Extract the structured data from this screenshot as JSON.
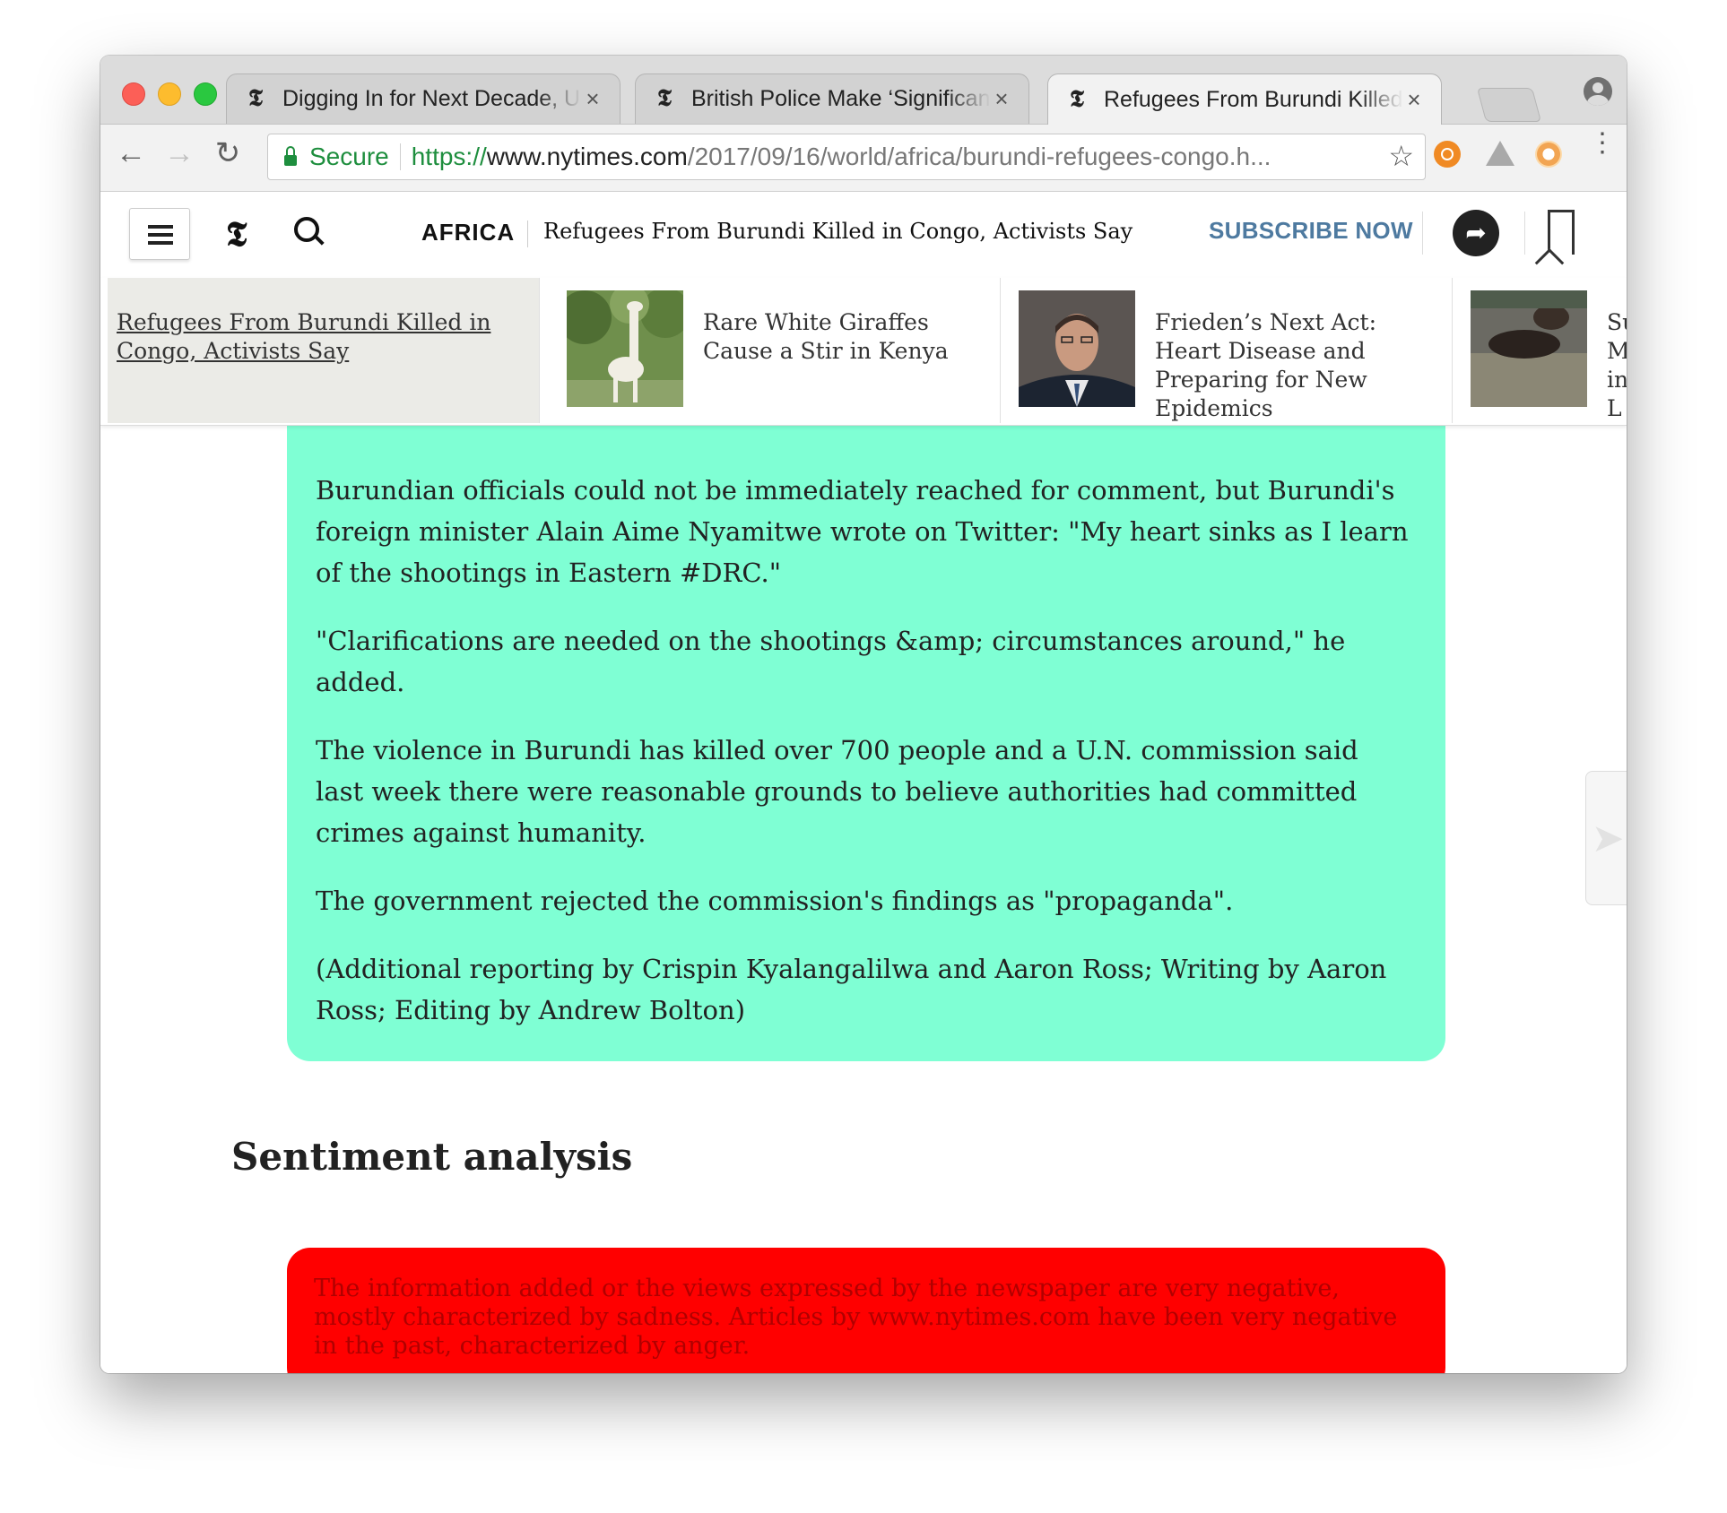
{
  "browser": {
    "tabs": [
      {
        "title": "Digging In for Next Decade, U.S.",
        "active": false
      },
      {
        "title": "British Police Make ‘Significant",
        "active": false
      },
      {
        "title": "Refugees From Burundi Killed in",
        "active": true
      }
    ],
    "tab_icon_glyph": "𝕿",
    "tab_close_glyph": "×",
    "secure_label": "Secure",
    "url_scheme": "https://",
    "url_host": "www.nytimes.com",
    "url_path": "/2017/09/16/world/africa/burundi-refugees-congo.h...",
    "back_glyph": "←",
    "forward_glyph": "→",
    "reload_glyph": "↻",
    "star_glyph": "☆",
    "menu_glyph": "⋮"
  },
  "header": {
    "logo_glyph": "𝕿",
    "section": "AFRICA",
    "title": "Refugees From Burundi Killed in Congo, Activists Say",
    "subscribe": "SUBSCRIBE NOW",
    "share_glyph": "➦"
  },
  "ribbon": {
    "current": "Refugees From Burundi Killed in Congo, Activists Say",
    "items": [
      {
        "title": "Rare White Giraffes Cause a Stir in Kenya"
      },
      {
        "title": "Frieden’s Next Act: Heart Disease and Preparing for New Epidemics"
      },
      {
        "title": "Sub Mig in L"
      }
    ]
  },
  "article": {
    "paragraphs": [
      "Burundian officials could not be immediately reached for comment, but Burundi's foreign minister Alain Aime Nyamitwe wrote on Twitter: \"My heart sinks as I learn of the shootings in Eastern #DRC.\"",
      "\"Clarifications are needed on the shootings &amp; circumstances around,\" he added.",
      "The violence in Burundi has killed over 700 people and a U.N. commission said last week there were reasonable grounds to believe authorities had committed crimes against humanity.",
      "The government rejected the commission's findings as \"propaganda\".",
      "(Additional reporting by Crispin Kyalangalilwa and Aaron Ross; Writing by Aaron Ross; Editing by Andrew Bolton)"
    ]
  },
  "sentiment": {
    "heading": "Sentiment analysis",
    "text": "The information added or the views expressed by the newspaper are very negative, mostly characterized by sadness. Articles by www.nytimes.com have been very negative in the past, characterized by anger."
  },
  "slide_arrow_glyph": "➤",
  "colors": {
    "article_bg": "#7fffd4",
    "sentiment_bg": "#ff0000",
    "subscribe": "#4e7aa0",
    "secure_green": "#1e8e3e"
  }
}
